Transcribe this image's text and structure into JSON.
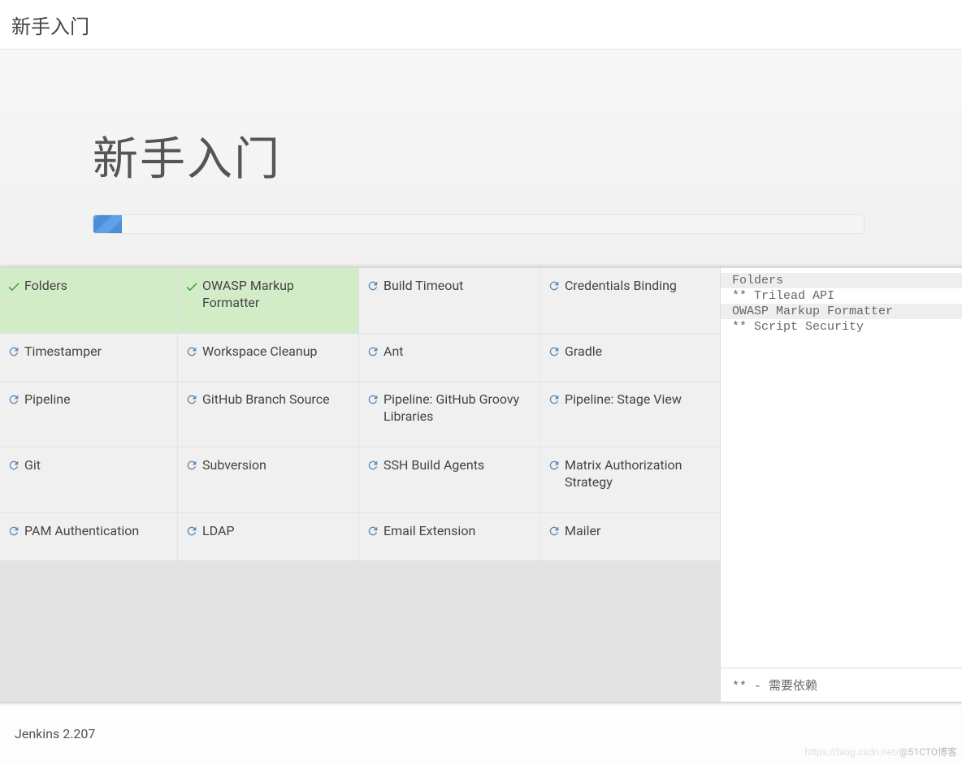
{
  "topbar": {
    "title": "新手入门"
  },
  "hero": {
    "title": "新手入门",
    "progress_percent": 3.7
  },
  "plugins": [
    {
      "name": "Folders",
      "status": "done"
    },
    {
      "name": "OWASP Markup Formatter",
      "status": "done"
    },
    {
      "name": "Build Timeout",
      "status": "pending"
    },
    {
      "name": "Credentials Binding",
      "status": "pending"
    },
    {
      "name": "Timestamper",
      "status": "pending"
    },
    {
      "name": "Workspace Cleanup",
      "status": "pending"
    },
    {
      "name": "Ant",
      "status": "pending"
    },
    {
      "name": "Gradle",
      "status": "pending"
    },
    {
      "name": "Pipeline",
      "status": "pending"
    },
    {
      "name": "GitHub Branch Source",
      "status": "pending"
    },
    {
      "name": "Pipeline: GitHub Groovy Libraries",
      "status": "pending"
    },
    {
      "name": "Pipeline: Stage View",
      "status": "pending"
    },
    {
      "name": "Git",
      "status": "pending"
    },
    {
      "name": "Subversion",
      "status": "pending"
    },
    {
      "name": "SSH Build Agents",
      "status": "pending"
    },
    {
      "name": "Matrix Authorization Strategy",
      "status": "pending"
    },
    {
      "name": "PAM Authentication",
      "status": "pending"
    },
    {
      "name": "LDAP",
      "status": "pending"
    },
    {
      "name": "Email Extension",
      "status": "pending"
    },
    {
      "name": "Mailer",
      "status": "pending"
    }
  ],
  "log": [
    {
      "text": "Folders",
      "kind": "done"
    },
    {
      "text": "** Trilead API",
      "kind": "dep"
    },
    {
      "text": "OWASP Markup Formatter",
      "kind": "done"
    },
    {
      "text": "** Script Security",
      "kind": "dep"
    }
  ],
  "legend": "** - 需要依赖",
  "footer": {
    "version": "Jenkins 2.207"
  },
  "watermark": {
    "faint": "https://blog.csdn.net/",
    "text": "@51CTO博客"
  }
}
